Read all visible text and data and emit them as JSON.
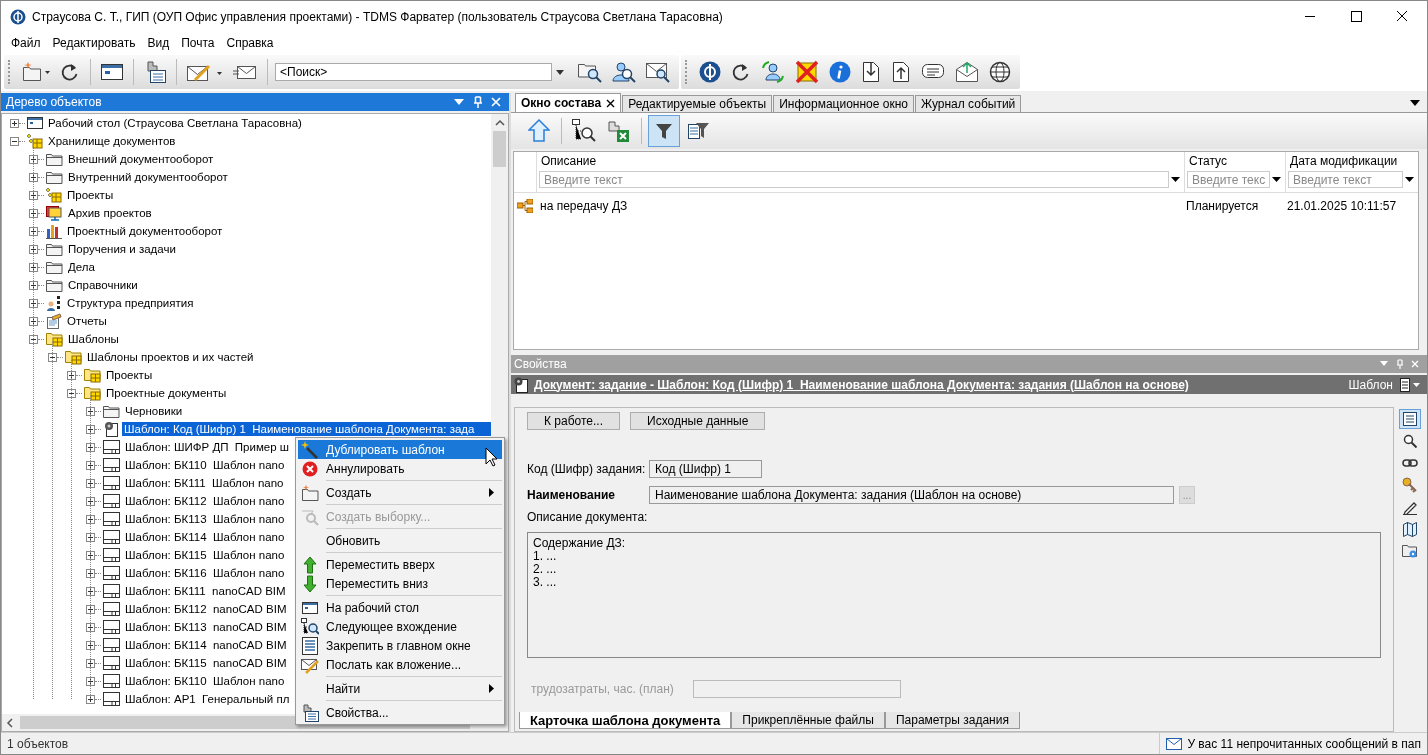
{
  "window": {
    "title": "Страусова С. Т., ГИП (ОУП Офис управления проектами) - TDMS Фарватер (пользователь Страусова Светлана Тарасовна)"
  },
  "menu_bar": [
    "Файл",
    "Редактировать",
    "Вид",
    "Почта",
    "Справка"
  ],
  "toolbar": {
    "search": {
      "placeholder": "<Поиск>"
    }
  },
  "object_tree": {
    "title": "Дерево объектов",
    "items": [
      {
        "label": "Рабочий стол (Страусова Светлана Тарасовна)",
        "kind": "desktop",
        "expanded": false,
        "selected": false
      },
      {
        "label": "Хранилище документов",
        "kind": "storage",
        "expanded": true,
        "selected": false,
        "children": [
          {
            "label": "Внешний документооборот",
            "kind": "folder",
            "expanded": false,
            "selected": false
          },
          {
            "label": "Внутренний документооборот",
            "kind": "folder",
            "expanded": false,
            "selected": false
          },
          {
            "label": "Проекты",
            "kind": "storage",
            "expanded": false,
            "selected": false
          },
          {
            "label": "Архив проектов",
            "kind": "archive",
            "expanded": false,
            "selected": false
          },
          {
            "label": "Проектный документооборот",
            "kind": "chart",
            "expanded": false,
            "selected": false
          },
          {
            "label": "Поручения и задачи",
            "kind": "folder",
            "expanded": false,
            "selected": false
          },
          {
            "label": "Дела",
            "kind": "folder",
            "expanded": false,
            "selected": false
          },
          {
            "label": "Справочники",
            "kind": "folder",
            "expanded": false,
            "selected": false
          },
          {
            "label": "Структура предприятия",
            "kind": "org",
            "expanded": false,
            "selected": false
          },
          {
            "label": "Отчеты",
            "kind": "report",
            "expanded": false,
            "selected": false
          },
          {
            "label": "Шаблоны",
            "kind": "template-folder",
            "expanded": true,
            "selected": false,
            "children": [
              {
                "label": "Шаблоны проектов и их частей",
                "kind": "template-folder",
                "expanded": true,
                "selected": false,
                "children": [
                  {
                    "label": "Проекты",
                    "kind": "template-folder",
                    "expanded": false,
                    "selected": false
                  },
                  {
                    "label": "Проектные документы",
                    "kind": "template-folder",
                    "expanded": true,
                    "selected": false,
                    "children": [
                      {
                        "label": "Черновики",
                        "kind": "folder",
                        "expanded": false,
                        "selected": false
                      },
                      {
                        "label": "Шаблон: Код (Шифр) 1  Наименование шаблона Документа: зада",
                        "kind": "doc-gear",
                        "expanded": false,
                        "selected": true
                      },
                      {
                        "label": "Шаблон: ШИФР ДП  Пример ш",
                        "kind": "template",
                        "expanded": false,
                        "selected": false
                      },
                      {
                        "label": "Шаблон: БК110  Шаблон nano",
                        "kind": "template",
                        "expanded": false,
                        "selected": false
                      },
                      {
                        "label": "Шаблон: БК111  Шаблон nano",
                        "kind": "template",
                        "expanded": false,
                        "selected": false
                      },
                      {
                        "label": "Шаблон: БК112  Шаблон nano",
                        "kind": "template",
                        "expanded": false,
                        "selected": false
                      },
                      {
                        "label": "Шаблон: БК113  Шаблон nano",
                        "kind": "template",
                        "expanded": false,
                        "selected": false
                      },
                      {
                        "label": "Шаблон: БК114  Шаблон nano",
                        "kind": "template",
                        "expanded": false,
                        "selected": false
                      },
                      {
                        "label": "Шаблон: БК115  Шаблон nano",
                        "kind": "template",
                        "expanded": false,
                        "selected": false
                      },
                      {
                        "label": "Шаблон: БК116  Шаблон nano",
                        "kind": "template",
                        "expanded": false,
                        "selected": false
                      },
                      {
                        "label": "Шаблон: БК111  nanoCAD BIM",
                        "kind": "template",
                        "expanded": false,
                        "selected": false
                      },
                      {
                        "label": "Шаблон: БК112  nanoCAD BIM",
                        "kind": "template",
                        "expanded": false,
                        "selected": false
                      },
                      {
                        "label": "Шаблон: БК113  nanoCAD BIM",
                        "kind": "template",
                        "expanded": false,
                        "selected": false
                      },
                      {
                        "label": "Шаблон: БК114  nanoCAD BIM",
                        "kind": "template",
                        "expanded": false,
                        "selected": false
                      },
                      {
                        "label": "Шаблон: БК115  nanoCAD BIM",
                        "kind": "template",
                        "expanded": false,
                        "selected": false
                      },
                      {
                        "label": "Шаблон: БК110  Шаблон nano",
                        "kind": "template",
                        "expanded": false,
                        "selected": false
                      },
                      {
                        "label": "Шаблон: АР1  Генеральный пл",
                        "kind": "template",
                        "expanded": false,
                        "selected": false
                      }
                    ]
                  }
                ]
              }
            ]
          }
        ]
      }
    ]
  },
  "context_menu": {
    "groups": [
      [
        {
          "label": "Дублировать шаблон",
          "kind": "wand",
          "selected": true,
          "disabled": false,
          "submenu": false
        },
        {
          "label": "Аннулировать",
          "kind": "cancel",
          "selected": false,
          "disabled": false,
          "submenu": false
        }
      ],
      [
        {
          "label": "Создать",
          "kind": "create",
          "selected": false,
          "disabled": false,
          "submenu": true
        }
      ],
      [
        {
          "label": "Создать выборку...",
          "kind": "query",
          "selected": false,
          "disabled": true,
          "submenu": false
        }
      ],
      [
        {
          "label": "Обновить",
          "kind": "plain",
          "selected": false,
          "disabled": false,
          "submenu": false
        }
      ],
      [
        {
          "label": "Переместить вверх",
          "kind": "up",
          "selected": false,
          "disabled": false,
          "submenu": false
        },
        {
          "label": "Переместить вниз",
          "kind": "down",
          "selected": false,
          "disabled": false,
          "submenu": false
        }
      ],
      [
        {
          "label": "На рабочий стол",
          "kind": "desktop",
          "selected": false,
          "disabled": false,
          "submenu": false
        },
        {
          "label": "Следующее вхождение",
          "kind": "next",
          "selected": false,
          "disabled": false,
          "submenu": false
        },
        {
          "label": "Закрепить в главном окне",
          "kind": "pin",
          "selected": false,
          "disabled": false,
          "submenu": false
        },
        {
          "label": "Послать как вложение...",
          "kind": "send",
          "selected": false,
          "disabled": false,
          "submenu": false
        }
      ],
      [
        {
          "label": "Найти",
          "kind": "plain",
          "selected": false,
          "disabled": false,
          "submenu": true
        }
      ],
      [
        {
          "label": "Свойства...",
          "kind": "properties",
          "selected": false,
          "disabled": false,
          "submenu": false
        }
      ]
    ]
  },
  "tree_status": "1 объектов",
  "tabs": [
    {
      "label": "Окно состава",
      "selected": true,
      "closable": true
    },
    {
      "label": "Редактируемые объекты",
      "selected": false,
      "closable": false
    },
    {
      "label": "Информационное окно",
      "selected": false,
      "closable": false
    },
    {
      "label": "Журнал событий",
      "selected": false,
      "closable": false
    }
  ],
  "composition_toolbar": {
    "filter_on": true
  },
  "grid": {
    "columns": [
      {
        "label": "Описание",
        "placeholder": "Введите текст"
      },
      {
        "label": "Статус",
        "placeholder": "Введите текс"
      },
      {
        "label": "Дата модификации",
        "placeholder": "Введите текст"
      }
    ],
    "rows": [
      {
        "cells": [
          "на передачу ДЗ",
          "Планируется",
          "21.01.2025 10:11:57"
        ],
        "selected": false
      }
    ]
  },
  "properties": {
    "title": "Свойства",
    "object_title": "Документ: задание - Шаблон: Код (Шифр) 1  Наименование шаблона Документа: задания (Шаблон на основе)",
    "type_label": "Шаблон",
    "buttons": [
      "К работе...",
      "Исходные данные"
    ],
    "code_field": {
      "label": "Код (Шифр) задания:",
      "value": "Код (Шифр) 1"
    },
    "name_field": {
      "label": "Наименование",
      "value": "Наименование шаблона Документа: задания (Шаблон на основе)",
      "browse": "..."
    },
    "description": {
      "label": "Описание документа:",
      "value": "Содержание ДЗ:\n1. ...\n2. ...\n3. ..."
    },
    "effort_field": {
      "label": "трудозатраты, час. (план)",
      "disabled": true
    },
    "tabs": [
      {
        "label": "Карточка шаблона документа",
        "selected": true
      },
      {
        "label": "Прикреплённые файлы",
        "selected": false
      },
      {
        "label": "Параметры задания",
        "selected": false
      }
    ],
    "side_tools": [
      {
        "kind": "card",
        "selected": true
      },
      {
        "kind": "search",
        "selected": false
      },
      {
        "kind": "link",
        "selected": false
      },
      {
        "kind": "key",
        "selected": false
      },
      {
        "kind": "pen",
        "selected": false
      },
      {
        "kind": "book",
        "selected": false
      },
      {
        "kind": "folder-gear",
        "selected": false
      }
    ]
  },
  "status_bar": {
    "message": "У вас 11 непрочитанных сообщений в пап"
  }
}
